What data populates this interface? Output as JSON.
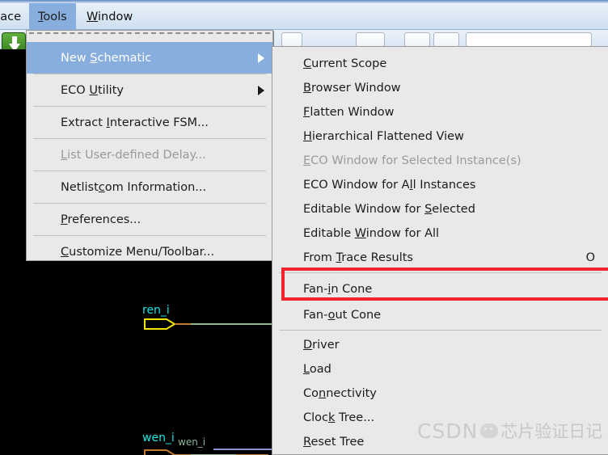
{
  "menubar": {
    "clipped_item": "ace",
    "items": [
      {
        "label": "Tools",
        "mnemonic_index": 1,
        "active": true
      },
      {
        "label": "Window",
        "mnemonic_index": 0,
        "active": false
      }
    ]
  },
  "toolbar": {
    "green_down_arrow_icon": "download-arrow-icon"
  },
  "tools_menu": {
    "tearoff": true,
    "items": [
      {
        "label": "New Schematic",
        "mnemonic_index": 4,
        "selected": true,
        "submenu": true,
        "disabled": false
      },
      {
        "label": "ECO Utility",
        "mnemonic_index": 4,
        "selected": false,
        "submenu": true,
        "disabled": false
      },
      {
        "label": "Extract Interactive FSM...",
        "mnemonic_index": 8,
        "selected": false,
        "submenu": false,
        "disabled": false
      },
      {
        "label": "List User-defined Delay...",
        "mnemonic_index": 0,
        "selected": false,
        "submenu": false,
        "disabled": true
      },
      {
        "label": "Netlistcom Information...",
        "mnemonic_index": 8,
        "selected": false,
        "submenu": false,
        "disabled": false
      },
      {
        "label": "Preferences...",
        "mnemonic_index": 0,
        "selected": false,
        "submenu": false,
        "disabled": false
      },
      {
        "label": "Customize Menu/Toolbar...",
        "mnemonic_index": 0,
        "selected": false,
        "submenu": false,
        "disabled": false
      }
    ]
  },
  "new_schematic_submenu": {
    "items": [
      {
        "label": "Current Scope",
        "mnemonic_index": 0,
        "accel": "",
        "disabled": false
      },
      {
        "label": "Browser Window",
        "mnemonic_index": 0,
        "accel": "",
        "disabled": false
      },
      {
        "label": "Flatten Window",
        "mnemonic_index": 0,
        "accel": "",
        "disabled": false
      },
      {
        "label": "Hierarchical Flattened View",
        "mnemonic_index": 0,
        "accel": "",
        "disabled": false
      },
      {
        "label": "ECO Window for Selected Instance(s)",
        "mnemonic_index": 0,
        "accel": "",
        "disabled": true
      },
      {
        "label": "ECO Window for All Instances",
        "mnemonic_index": 15,
        "accel": "",
        "disabled": false
      },
      {
        "label": "Editable Window for Selected",
        "mnemonic_index": 19,
        "accel": "",
        "disabled": false
      },
      {
        "label": "Editable Window for All",
        "mnemonic_index": 9,
        "accel": "",
        "disabled": false
      },
      {
        "label": "From Trace Results",
        "mnemonic_index": 5,
        "accel": "O",
        "disabled": false
      },
      {
        "label": "Fan-in Cone",
        "mnemonic_index": 4,
        "accel": "",
        "disabled": false,
        "highlighted": true
      },
      {
        "label": "Fan-out Cone",
        "mnemonic_index": 4,
        "accel": "",
        "disabled": false
      },
      {
        "label": "Driver",
        "mnemonic_index": 0,
        "accel": "",
        "disabled": false
      },
      {
        "label": "Load",
        "mnemonic_index": 0,
        "accel": "",
        "disabled": false
      },
      {
        "label": "Connectivity",
        "mnemonic_index": 2,
        "accel": "",
        "disabled": false
      },
      {
        "label": "Clock Tree...",
        "mnemonic_index": 4,
        "accel": "",
        "disabled": false
      },
      {
        "label": "Reset Tree",
        "mnemonic_index": 0,
        "accel": "",
        "disabled": false
      }
    ]
  },
  "annotation": {
    "target_label": "Fan-in Cone",
    "box_color": "#f2212b"
  },
  "canvas": {
    "background_color": "#000000",
    "signals": [
      {
        "name": "ren_i",
        "color": "#19e3e3",
        "port_color": "#f2e400",
        "ghost": false
      },
      {
        "name": "wen_i",
        "color": "#19e3e3",
        "port_color": "#c07a2a",
        "ghost": false
      },
      {
        "name": "wen_i",
        "color": "#8fb39a",
        "port_color": "",
        "ghost": true
      }
    ]
  },
  "watermark": {
    "brand": "CSDN",
    "icon": "wechat-icon",
    "account": "芯片验证日记"
  }
}
